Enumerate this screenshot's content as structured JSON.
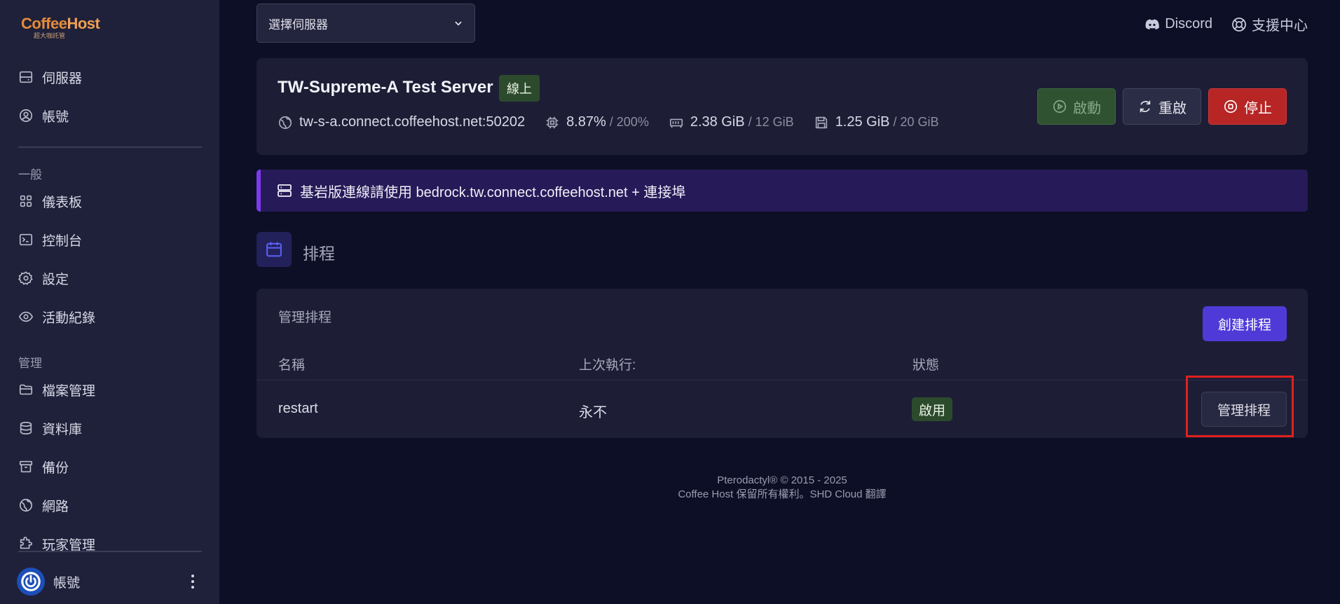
{
  "brand": {
    "name_part1": "Coffee",
    "name_part2": "Host",
    "tagline": "超大咖託管"
  },
  "sidebar": {
    "top_items": [
      {
        "label": "伺服器",
        "icon": "server-icon"
      },
      {
        "label": "帳號",
        "icon": "user-circle-icon"
      }
    ],
    "general_label": "一般",
    "general_items": [
      {
        "label": "儀表板",
        "icon": "grid-icon"
      },
      {
        "label": "控制台",
        "icon": "terminal-icon"
      },
      {
        "label": "設定",
        "icon": "gear-icon"
      },
      {
        "label": "活動紀錄",
        "icon": "eye-icon"
      }
    ],
    "manage_label": "管理",
    "manage_items": [
      {
        "label": "檔案管理",
        "icon": "folder-icon"
      },
      {
        "label": "資料庫",
        "icon": "database-icon"
      },
      {
        "label": "備份",
        "icon": "archive-icon"
      },
      {
        "label": "網路",
        "icon": "globe-icon"
      },
      {
        "label": "玩家管理",
        "icon": "puzzle-icon"
      }
    ],
    "account_label": "帳號"
  },
  "topbar": {
    "server_select": "選擇伺服器",
    "discord": "Discord",
    "support": "支援中心"
  },
  "server": {
    "name": "TW-Supreme-A Test Server",
    "status": "線上",
    "address": "tw-s-a.connect.coffeehost.net:50202",
    "cpu": "8.87%",
    "cpu_limit": "/ 200%",
    "memory": "2.38 GiB",
    "memory_limit": "/ 12 GiB",
    "disk": "1.25 GiB",
    "disk_limit": "/ 20 GiB",
    "buttons": {
      "start": "啟動",
      "restart": "重啟",
      "stop": "停止"
    }
  },
  "alert": {
    "text": "基岩版連線請使用 bedrock.tw.connect.coffeehost.net + 連接埠"
  },
  "section": {
    "title": "排程"
  },
  "schedules": {
    "card_title": "管理排程",
    "create_button": "創建排程",
    "columns": [
      "名稱",
      "上次執行:",
      "狀態"
    ],
    "rows": [
      {
        "name": "restart",
        "last_run": "永不",
        "status": "啟用",
        "action": "管理排程"
      }
    ]
  },
  "footer": {
    "line1": "Pterodactyl® © 2015 - 2025",
    "line2": "Coffee Host 保留所有權利。SHD Cloud 翻譯"
  },
  "colors": {
    "background": "#0d0f26",
    "sidebar": "#1f2039",
    "card": "#1d1e36",
    "accent": "#4f3ad8",
    "success": "#2c4a2c",
    "danger": "#b72525",
    "alert": "#7c3aed"
  }
}
